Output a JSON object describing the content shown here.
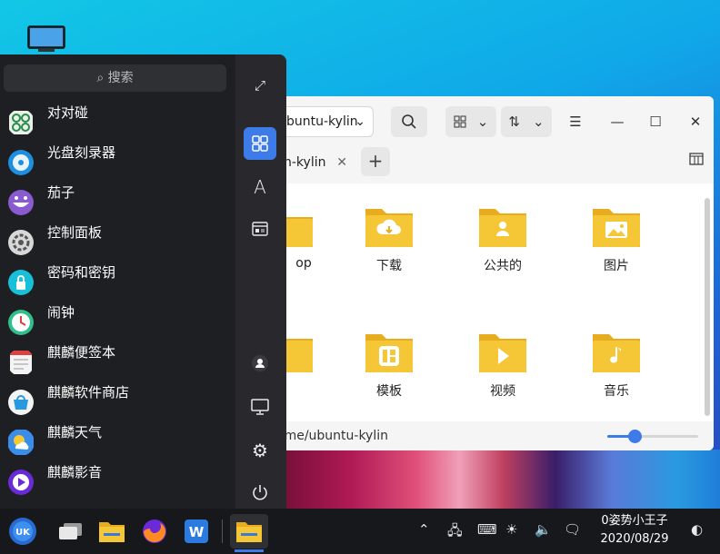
{
  "file_manager": {
    "path_dropdown": "buntu-kylin",
    "tab_label": "n-kylin",
    "files": [
      {
        "name": "op",
        "icon": "desktop-folder-icon"
      },
      {
        "name": "下载",
        "icon": "download-folder-icon"
      },
      {
        "name": "公共的",
        "icon": "public-folder-icon"
      },
      {
        "name": "图片",
        "icon": "pictures-folder-icon"
      },
      {
        "name": "",
        "icon": "documents-folder-icon"
      },
      {
        "name": "模板",
        "icon": "templates-folder-icon"
      },
      {
        "name": "视频",
        "icon": "videos-folder-icon"
      },
      {
        "name": "音乐",
        "icon": "music-folder-icon"
      }
    ],
    "status_path": "ome/ubuntu-kylin",
    "zoom_fraction": 0.3,
    "folder_color": "#f5c635"
  },
  "start_menu": {
    "search_placeholder": "搜索",
    "apps": [
      {
        "label": "对对碰",
        "icon": "matching-game-icon"
      },
      {
        "label": "光盘刻录器",
        "icon": "disc-burner-icon"
      },
      {
        "label": "茄子",
        "icon": "cheese-camera-icon"
      },
      {
        "label": "控制面板",
        "icon": "control-panel-icon"
      },
      {
        "label": "密码和密钥",
        "icon": "passwords-keys-icon"
      },
      {
        "label": "闹钟",
        "icon": "alarm-clock-icon"
      },
      {
        "label": "麒麟便签本",
        "icon": "kylin-notes-icon"
      },
      {
        "label": "麒麟软件商店",
        "icon": "kylin-software-store-icon"
      },
      {
        "label": "麒麟天气",
        "icon": "kylin-weather-icon"
      },
      {
        "label": "麒麟影音",
        "icon": "kylin-video-icon"
      }
    ],
    "accent_color": "#3d7be8"
  },
  "taskbar": {
    "clock_time": "0姿势小王子",
    "clock_date": "2020/08/29"
  }
}
